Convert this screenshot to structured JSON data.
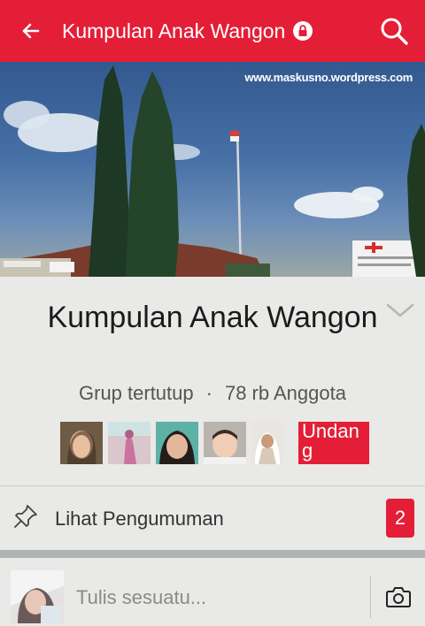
{
  "header": {
    "title": "Kumpulan Anak Wangon",
    "back_icon": "arrow-left-icon",
    "privacy_icon": "lock-icon",
    "search_icon": "search-icon"
  },
  "cover": {
    "watermark": "www.maskusno.wordpress.com"
  },
  "group": {
    "name": "Kumpulan Anak Wangon",
    "privacy": "Grup tertutup",
    "separator": "·",
    "members": "78 rb Anggota",
    "invite_label": "Undang"
  },
  "announcements": {
    "label": "Lihat Pengumuman",
    "count": "2"
  },
  "composer": {
    "placeholder": "Tulis sesuatu..."
  },
  "colors": {
    "brand": "#e41e36",
    "background": "#e9e9e7"
  }
}
